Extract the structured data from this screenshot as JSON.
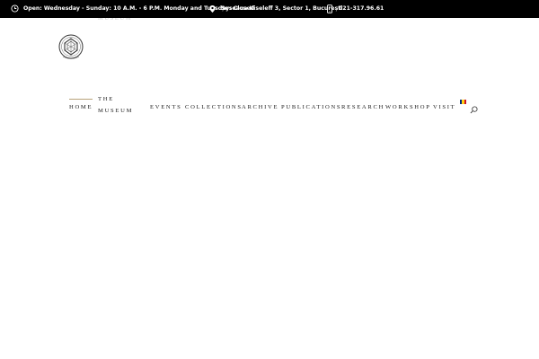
{
  "topbar": {
    "hours": "Open: Wednesday - Sunday: 10 A.M. - 6 P.M. Monday and Tuesday: Closed",
    "address": "Șoseaua Kiseleff 3, Sector 1, București",
    "phone": "021-317.96.61",
    "icons": [
      "clock-icon",
      "location-pin-icon",
      "phone-icon"
    ]
  },
  "logo": {
    "icon": "museum-seal-logo"
  },
  "nav": {
    "items": [
      {
        "label": "HOME"
      },
      {
        "label_line1": "THE",
        "label_line2": "MUSEUM"
      },
      {
        "label": "EVENTS"
      },
      {
        "label": "COLLECTIONS"
      },
      {
        "label": "ARCHIVE"
      },
      {
        "label": "PUBLICATIONS"
      },
      {
        "label": "RESEARCH"
      },
      {
        "label": "WORKSHOP"
      },
      {
        "label": "VISIT"
      }
    ],
    "active": "HOME",
    "language_flag": "romanian-flag-icon",
    "search_icon": "search-icon"
  },
  "colors": {
    "topbar_bg": "#000000",
    "topbar_text": "#ffffff",
    "nav_text": "#222222",
    "active_underline": "#b8a27a",
    "flag": [
      "#002b7f",
      "#fcd116",
      "#ce1126"
    ]
  }
}
